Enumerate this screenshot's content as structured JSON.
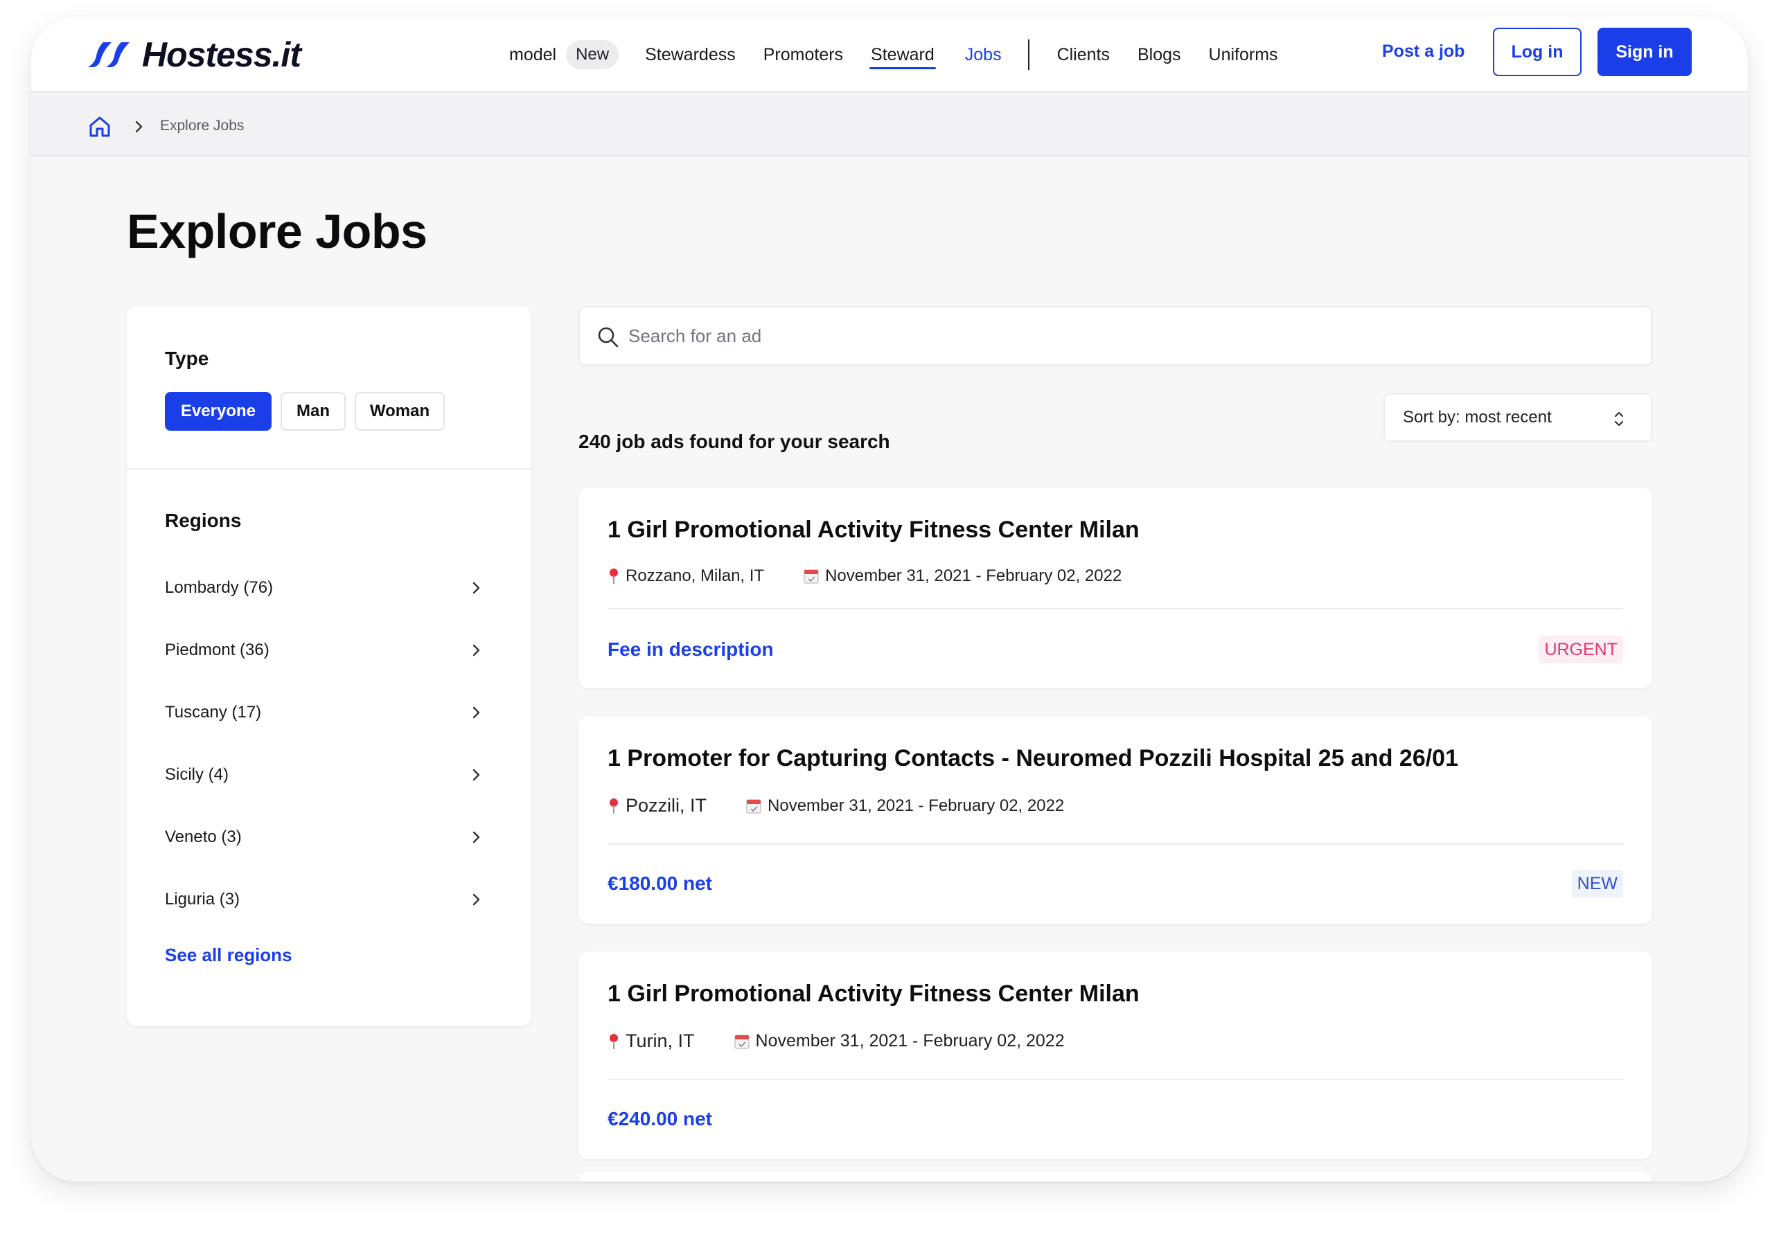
{
  "header": {
    "logo_text": "Hostess.it",
    "nav": [
      {
        "label": "model",
        "pill": "New"
      },
      {
        "label": "Stewardess"
      },
      {
        "label": "Promoters"
      },
      {
        "label": "Steward"
      },
      {
        "label": "Jobs"
      },
      {
        "label": "Clients"
      },
      {
        "label": "Blogs"
      },
      {
        "label": "Uniforms"
      }
    ],
    "post_job": "Post a job",
    "login": "Log in",
    "signin": "Sign in"
  },
  "breadcrumb": {
    "current": "Explore Jobs"
  },
  "page": {
    "title": "Explore Jobs"
  },
  "filters": {
    "type_title": "Type",
    "types": [
      "Everyone",
      "Man",
      "Woman"
    ],
    "selected_type": "Everyone",
    "regions_title": "Regions",
    "regions": [
      "Lombardy (76)",
      "Piedmont (36)",
      "Tuscany (17)",
      "Sicily (4)",
      "Veneto (3)",
      "Liguria (3)"
    ],
    "see_all": "See all regions"
  },
  "search": {
    "placeholder": "Search for an ad"
  },
  "results": {
    "count_text": "240 job ads found for your search",
    "sort_label": "Sort by: most recent"
  },
  "jobs": [
    {
      "title": "1 Girl Promotional Activity Fitness Center Milan",
      "location": "Rozzano, Milan, IT",
      "dates": "November 31, 2021 - February 02, 2022",
      "fee": "Fee in description",
      "badge": "URGENT"
    },
    {
      "title": "1 Promoter for Capturing Contacts - Neuromed Pozzili Hospital 25 and 26/01",
      "location": "Pozzili, IT",
      "dates": "November 31, 2021 - February 02, 2022",
      "fee": "€180.00 net",
      "badge": "NEW"
    },
    {
      "title": "1 Girl Promotional Activity Fitness Center Milan",
      "location": "Turin, IT",
      "dates": "November 31, 2021 - February 02, 2022",
      "fee": "€240.00 net",
      "badge": ""
    }
  ],
  "colors": {
    "accent": "#1a3fe8",
    "urgent": "#e2386f",
    "new": "#2e55c8"
  }
}
